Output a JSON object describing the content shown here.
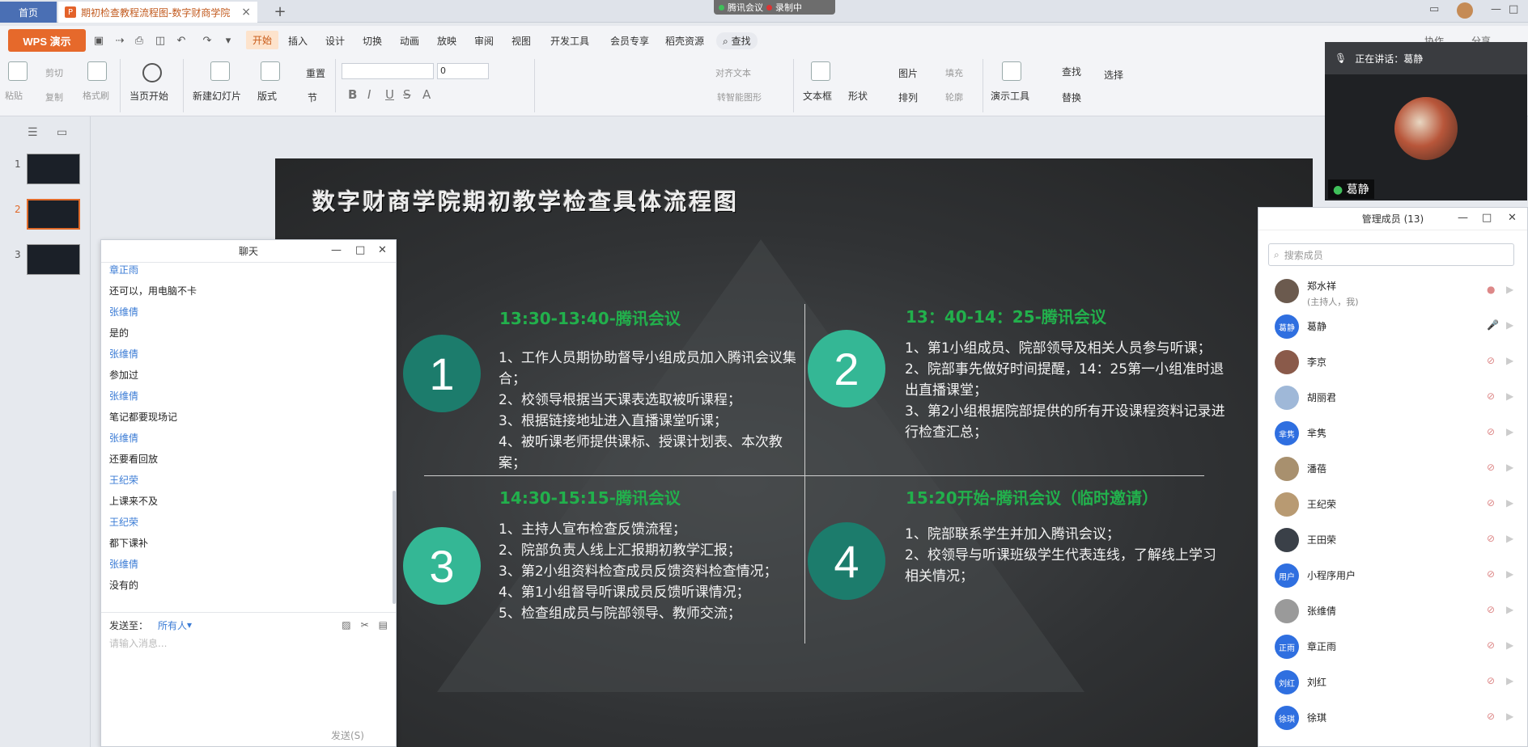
{
  "tabs": {
    "home": "首页",
    "doc": "期初检查教程流程图-数字财商学院"
  },
  "meeting_pill": {
    "app": "腾讯会议",
    "recording": "录制中"
  },
  "menu": {
    "wps": "WPS 演示",
    "items": [
      "开始",
      "插入",
      "设计",
      "切换",
      "动画",
      "放映",
      "审阅",
      "视图",
      "开发工具",
      "会员专享",
      "稻壳资源"
    ],
    "search": "查找",
    "collab": "协作",
    "share": "分享"
  },
  "ribbon": {
    "paste": "粘贴",
    "cut": "剪切",
    "copy": "复制",
    "format_painter": "格式刷",
    "from_current": "当页开始",
    "new_slide": "新建幻灯片",
    "layout": "版式",
    "reset": "重置",
    "section": "节",
    "font_size": "0",
    "align_text": "对齐文本",
    "smart_shape": "转智能图形",
    "textbox": "文本框",
    "shape": "形状",
    "picture": "图片",
    "arrange": "排列",
    "fill": "填充",
    "outline": "轮廓",
    "presenter": "演示工具",
    "find": "查找",
    "replace": "替换",
    "select": "选择"
  },
  "thumbs": [
    "1",
    "2",
    "3"
  ],
  "slide": {
    "title": "数字财商学院期初教学检查具体流程图",
    "quadrants": [
      {
        "num": "1",
        "heading": "13:30-13:40-腾讯会议",
        "lines": [
          "1、工作人员期协助督导小组成员加入腾讯会议集合；",
          "2、校领导根据当天课表选取被听课程；",
          "3、根据链接地址进入直播课堂听课；",
          "4、被听课老师提供课标、授课计划表、本次教案；"
        ]
      },
      {
        "num": "2",
        "heading": "13：40-14：25-腾讯会议",
        "lines": [
          "1、第1小组成员、院部领导及相关人员参与听课；",
          "2、院部事先做好时间提醒，14：25第一小组准时退出直播课堂；",
          "3、第2小组根据院部提供的所有开设课程资料记录进行检查汇总；"
        ]
      },
      {
        "num": "3",
        "heading": "14:30-15:15-腾讯会议",
        "lines": [
          "1、主持人宣布检查反馈流程；",
          "2、院部负责人线上汇报期初教学汇报；",
          "3、第2小组资料检查成员反馈资料检查情况；",
          "4、第1小组督导听课成员反馈听课情况；",
          "5、检查组成员与院部领导、教师交流；"
        ]
      },
      {
        "num": "4",
        "heading": "15:20开始-腾讯会议（临时邀请）",
        "lines": [
          "1、院部联系学生并加入腾讯会议；",
          "2、校领导与听课班级学生代表连线，了解线上学习相关情况；"
        ]
      }
    ]
  },
  "chat": {
    "title": "聊天",
    "messages": [
      {
        "t": "name",
        "text": "章正雨"
      },
      {
        "t": "msg",
        "text": "还可以，用电脑不卡"
      },
      {
        "t": "name",
        "text": "张维倩"
      },
      {
        "t": "msg",
        "text": "是的"
      },
      {
        "t": "name",
        "text": "张维倩"
      },
      {
        "t": "msg",
        "text": "参加过"
      },
      {
        "t": "name",
        "text": "张维倩"
      },
      {
        "t": "msg",
        "text": "笔记都要现场记"
      },
      {
        "t": "name",
        "text": "张维倩"
      },
      {
        "t": "msg",
        "text": "还要看回放"
      },
      {
        "t": "name",
        "text": "王纪荣"
      },
      {
        "t": "msg",
        "text": "上课来不及"
      },
      {
        "t": "name",
        "text": "王纪荣"
      },
      {
        "t": "msg",
        "text": "都下课补"
      },
      {
        "t": "name",
        "text": "张维倩"
      },
      {
        "t": "msg",
        "text": "没有的"
      }
    ],
    "send_to_label": "发送至：",
    "send_to_value": "所有人",
    "input_placeholder": "请输入消息...",
    "send_button": "发送(S)"
  },
  "video": {
    "speaking": "正在讲话：葛静",
    "name": "葛静"
  },
  "members": {
    "title": "管理成员 (13)",
    "search_placeholder": "搜索成员",
    "list": [
      {
        "name": "郑水祥",
        "sub": "(主持人，我)",
        "avatar": "",
        "color": "#6b5a4e"
      },
      {
        "name": "葛静",
        "sub": "",
        "avatar": "葛静",
        "color": "#2f6fe0"
      },
      {
        "name": "李京",
        "sub": "",
        "avatar": "",
        "color": "#8a5a4a"
      },
      {
        "name": "胡丽君",
        "sub": "",
        "avatar": "",
        "color": "#9fb8d8"
      },
      {
        "name": "芈隽",
        "sub": "",
        "avatar": "芈隽",
        "color": "#2f6fe0"
      },
      {
        "name": "潘蓓",
        "sub": "",
        "avatar": "",
        "color": "#a8906e"
      },
      {
        "name": "王纪荣",
        "sub": "",
        "avatar": "",
        "color": "#b89a72"
      },
      {
        "name": "王田荣",
        "sub": "",
        "avatar": "",
        "color": "#3a4048"
      },
      {
        "name": "小程序用户",
        "sub": "",
        "avatar": "用户",
        "color": "#2f6fe0"
      },
      {
        "name": "张维倩",
        "sub": "",
        "avatar": "",
        "color": "#9a9a9a"
      },
      {
        "name": "章正雨",
        "sub": "",
        "avatar": "正雨",
        "color": "#2f6fe0"
      },
      {
        "name": "刘红",
        "sub": "",
        "avatar": "刘红",
        "color": "#2f6fe0"
      },
      {
        "name": "徐琪",
        "sub": "",
        "avatar": "徐琪",
        "color": "#2f6fe0"
      }
    ]
  }
}
